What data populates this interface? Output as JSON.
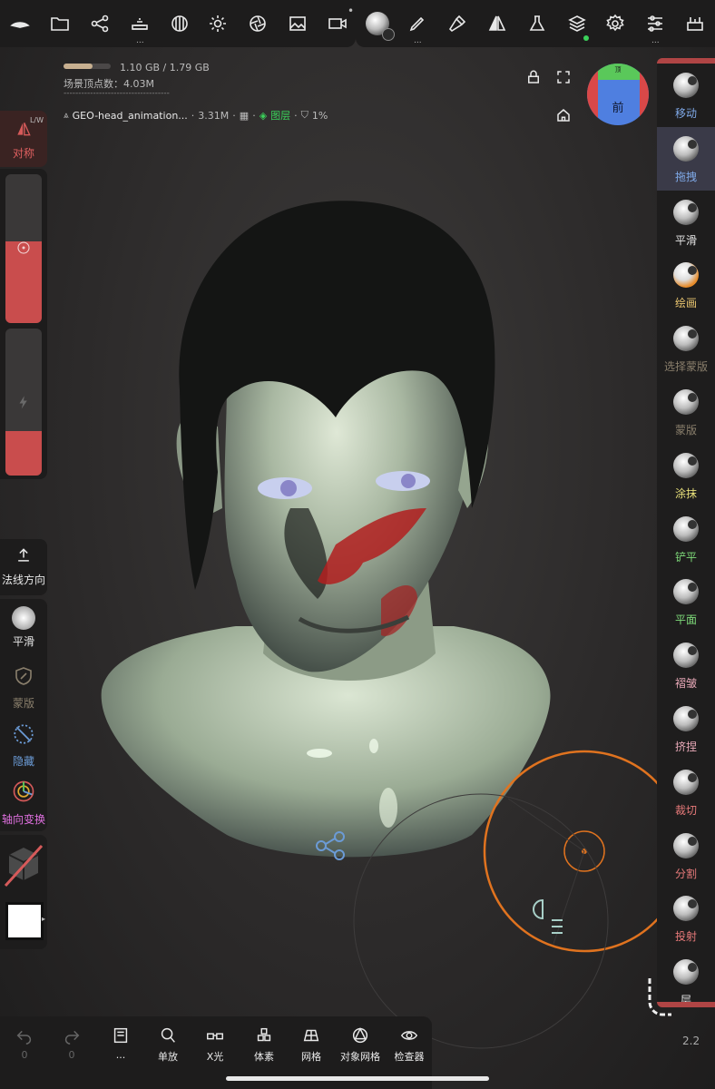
{
  "top_toolbar": {
    "icons": [
      "hat-icon",
      "folder-icon",
      "share-nodes-icon",
      "pyramid-icon",
      "sphere-grid-icon",
      "sun-icon",
      "aperture-icon",
      "image-icon",
      "camera-icon",
      "brush-ball-icon",
      "pen-icon",
      "hammer-icon",
      "symmetry-icon",
      "flask-icon",
      "layers-icon",
      "settings-icon",
      "sliders-icon",
      "tool-box-icon"
    ],
    "more_dots": "•••",
    "ellipsis": "..."
  },
  "info": {
    "memory": "1.10 GB / 1.79 GB",
    "memory_fraction": 0.61,
    "scene_vertices": "场景顶点数：4.03M",
    "divider": "------------------------------------",
    "object_name": "GEO-head_animation...",
    "object_vertices": "3.31M",
    "layers_label": "图层",
    "percent": "1%"
  },
  "view_cube": {
    "front_label": "前",
    "top_label": "顶"
  },
  "left_panel": {
    "symmetry_label": "对称",
    "symmetry_corner": "L/W",
    "normal_label": "法线方向",
    "tools": [
      "平滑",
      "蒙版",
      "隐藏",
      "轴向变换"
    ],
    "radius_fraction": 0.55,
    "intensity_fraction": 0.3
  },
  "right_tools": [
    {
      "label": "移动",
      "color": "#7fa9e8"
    },
    {
      "label": "拖拽",
      "color": "#7fa9e8",
      "active": true
    },
    {
      "label": "平滑",
      "color": "#e8e8e8"
    },
    {
      "label": "绘画",
      "color": "#e8c46f"
    },
    {
      "label": "选择蒙版",
      "color": "#8a7f6c"
    },
    {
      "label": "蒙版",
      "color": "#8a7f6c"
    },
    {
      "label": "涂抹",
      "color": "#e8e07a"
    },
    {
      "label": "铲平",
      "color": "#7fdc7a"
    },
    {
      "label": "平面",
      "color": "#7fdc7a"
    },
    {
      "label": "褶皱",
      "color": "#e8a9b8"
    },
    {
      "label": "挤捏",
      "color": "#e8a9b8"
    },
    {
      "label": "裁切",
      "color": "#e87a7a"
    },
    {
      "label": "分割",
      "color": "#e87a7a"
    },
    {
      "label": "投射",
      "color": "#e87a7a"
    },
    {
      "label": "层",
      "color": "#e8e8e8"
    }
  ],
  "bottom_toolbar": [
    {
      "label": "0",
      "icon": "undo-icon",
      "dim": true
    },
    {
      "label": "0",
      "icon": "redo-icon",
      "dim": true
    },
    {
      "label": "...",
      "icon": "book-icon"
    },
    {
      "label": "单放",
      "icon": "search-icon"
    },
    {
      "label": "X光",
      "icon": "glasses-icon"
    },
    {
      "label": "体素",
      "icon": "voxel-icon"
    },
    {
      "label": "网格",
      "icon": "grid-icon"
    },
    {
      "label": "对象网格",
      "icon": "wire-sphere-icon"
    },
    {
      "label": "检查器",
      "icon": "eye-icon"
    }
  ],
  "version": "2.2",
  "colors": {
    "accent_red": "#c94d4d",
    "orange": "#e0731f",
    "green": "#3bd15a"
  }
}
